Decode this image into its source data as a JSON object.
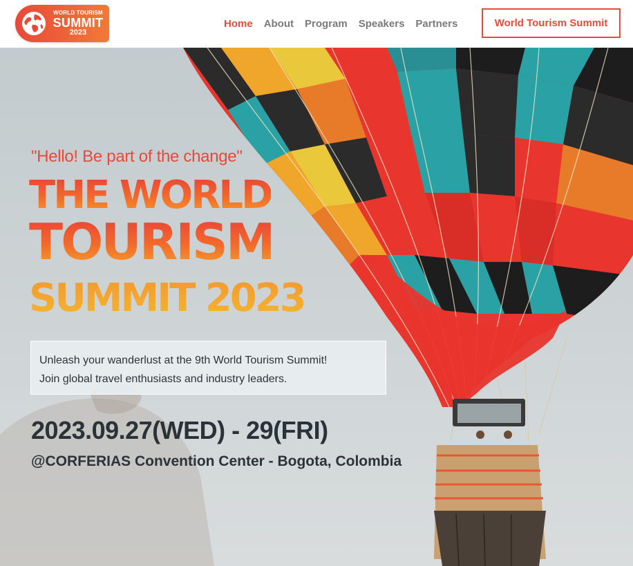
{
  "header": {
    "logo": {
      "top": "WORLD TOURISM",
      "mid": "SUMMIT",
      "bottom": "2023"
    },
    "nav": [
      {
        "label": "Home",
        "active": true
      },
      {
        "label": "About",
        "active": false
      },
      {
        "label": "Program",
        "active": false
      },
      {
        "label": "Speakers",
        "active": false
      },
      {
        "label": "Partners",
        "active": false
      }
    ],
    "cta_label": "World Tourism Summit"
  },
  "hero": {
    "tagline": "\"Hello! Be part of the change\"",
    "title_line1": "THE WORLD",
    "title_line2": "TOURISM",
    "title_line3": "SUMMIT 2023",
    "description_line1": "Unleash your wanderlust at the 9th World Tourism Summit!",
    "description_line2": "Join global travel enthusiasts and industry leaders.",
    "date": "2023.09.27(WED) - 29(FRI)",
    "venue": "@CORFERIAS Convention Center - Bogota, Colombia"
  },
  "colors": {
    "accent": "#e8493a",
    "text_dark": "#2b3238",
    "nav_gray": "#7a7a7a"
  }
}
